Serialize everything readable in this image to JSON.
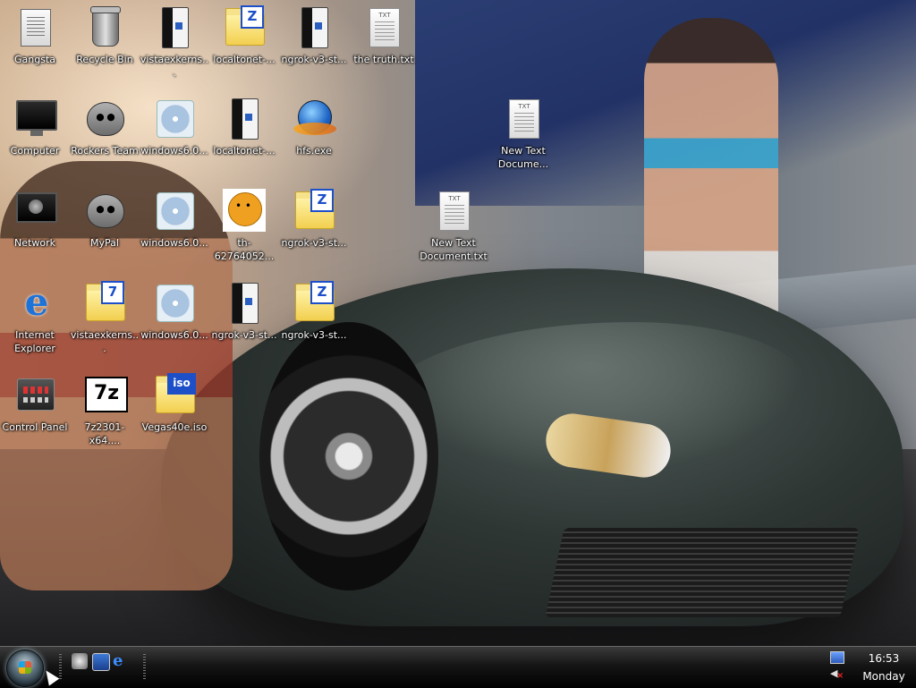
{
  "desktop": {
    "icons": [
      {
        "id": "gangsta",
        "label": "Gangsta",
        "icon": "notepad-icon"
      },
      {
        "id": "recycle-bin",
        "label": "Recycle Bin",
        "icon": "recycle-bin-icon"
      },
      {
        "id": "vistaexkerns-1",
        "label": "vistaexkerns...",
        "icon": "book-icon"
      },
      {
        "id": "localtonet-1",
        "label": "localtonet-...",
        "icon": "archive-folder-icon",
        "badge": "Z"
      },
      {
        "id": "ngrok-1",
        "label": "ngrok-v3-st...",
        "icon": "book-icon"
      },
      {
        "id": "the-truth",
        "label": "the truth.txt",
        "icon": "text-file-icon",
        "badge": "TXT"
      },
      {
        "id": "computer",
        "label": "Computer",
        "icon": "monitor-icon"
      },
      {
        "id": "rockers-team",
        "label": "Rockers Team",
        "icon": "raccoon-icon"
      },
      {
        "id": "windows60-1",
        "label": "windows6.0...",
        "icon": "disc-icon"
      },
      {
        "id": "localtonet-2",
        "label": "localtonet-...",
        "icon": "book-icon"
      },
      {
        "id": "hfs",
        "label": "hfs.exe",
        "icon": "globe-icon"
      },
      {
        "id": "new-text-1",
        "label": "New Text Docume...",
        "icon": "text-file-icon",
        "badge": "TXT"
      },
      {
        "id": "network",
        "label": "Network",
        "icon": "network-icon"
      },
      {
        "id": "mypal",
        "label": "MyPal",
        "icon": "raccoon-icon"
      },
      {
        "id": "windows60-2",
        "label": "windows6.0...",
        "icon": "disc-icon"
      },
      {
        "id": "th-627",
        "label": "th-62764052...",
        "icon": "face-image-icon"
      },
      {
        "id": "ngrok-2",
        "label": "ngrok-v3-st...",
        "icon": "archive-folder-icon",
        "badge": "Z"
      },
      {
        "id": "new-text-2",
        "label": "New Text Document.txt",
        "icon": "text-file-icon",
        "badge": "TXT"
      },
      {
        "id": "ie",
        "label": "Internet Explorer",
        "icon": "internet-explorer-icon"
      },
      {
        "id": "vistaexkerns-2",
        "label": "vistaexkerns...",
        "icon": "archive-folder-icon",
        "badge": "7"
      },
      {
        "id": "windows60-3",
        "label": "windows6.0...",
        "icon": "disc-icon"
      },
      {
        "id": "ngrok-3",
        "label": "ngrok-v3-st...",
        "icon": "book-icon"
      },
      {
        "id": "ngrok-4",
        "label": "ngrok-v3-st...",
        "icon": "archive-folder-icon",
        "badge": "Z"
      },
      {
        "id": "control-panel",
        "label": "Control Panel",
        "icon": "control-panel-icon"
      },
      {
        "id": "7z2301",
        "label": "7z2301-x64....",
        "icon": "sevenzip-icon",
        "badge": "7z"
      },
      {
        "id": "vegas",
        "label": "Vegas40e.iso",
        "icon": "iso-folder-icon",
        "badge": "iso"
      }
    ]
  },
  "taskbar": {
    "quick_launch": [
      "show-desktop-icon",
      "switch-windows-icon",
      "internet-explorer-icon"
    ],
    "ql_ie_glyph": "e",
    "clock_time": "16:53",
    "clock_day": "Monday",
    "volume_glyph": "◀",
    "volume_muted": "×"
  }
}
